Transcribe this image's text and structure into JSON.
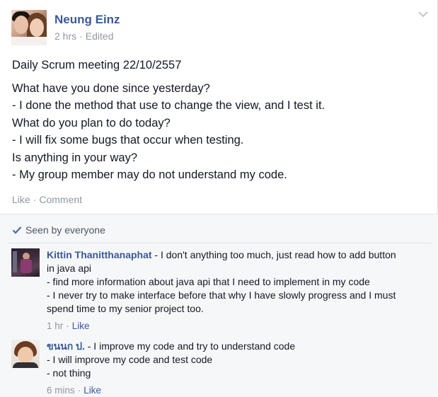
{
  "post": {
    "author": "Neung Einz",
    "time": "2 hrs",
    "edited": "Edited",
    "lines": [
      "Daily Scrum meeting 22/10/2557",
      "What have you done since yesterday?",
      "- I done the method that use to change the view, and I test it.",
      "What do you plan to do today?",
      "- I will fix some bugs that occur when testing.",
      "Is anything in your way?",
      "- My group member may do not understand my code."
    ],
    "actions": {
      "like": "Like",
      "comment": "Comment"
    }
  },
  "feedback": {
    "seen": "Seen by everyone",
    "comments": [
      {
        "author": "Kittin Thanitthanaphat",
        "first_line": " - I don't anything too much, just read how to add button",
        "lines": [
          "in java api",
          "- find more information about java api that I need to implement in my code",
          "- I never try to make interface before that why I have slowly progress and I must",
          "spend time to my senior project too."
        ],
        "time": "1 hr",
        "like": "Like"
      },
      {
        "author": "ขนนก ป.",
        "first_line": " - I improve my code and try to understand code",
        "lines": [
          "- I will improve my code and test code",
          "- not thing"
        ],
        "time": "6 mins",
        "like": "Like"
      }
    ]
  },
  "colors": {
    "link": "#3b5998",
    "meta": "#9197a3",
    "text": "#141823",
    "feedback_bg": "#f6f7f9"
  },
  "icons": [
    "chevron-down-icon",
    "checkmark-icon"
  ]
}
